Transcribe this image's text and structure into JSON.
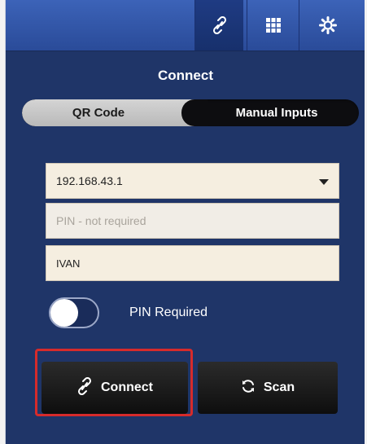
{
  "toolbar": {
    "icons": [
      "link-icon",
      "grid-icon",
      "gear-icon"
    ],
    "active": "link-icon"
  },
  "title": "Connect",
  "segment": {
    "options": [
      "QR Code",
      "Manual Inputs"
    ],
    "selected": "Manual Inputs"
  },
  "form": {
    "ip_value": "192.168.43.1",
    "pin_placeholder": "PIN - not required",
    "name_value": "IVAN"
  },
  "pin_toggle": {
    "label": "PIN Required",
    "on": false
  },
  "buttons": {
    "connect_label": "Connect",
    "scan_label": "Scan"
  },
  "colors": {
    "panel": "#1f3568",
    "toolbar": "#2a4b99",
    "highlight": "#d62b2b"
  }
}
